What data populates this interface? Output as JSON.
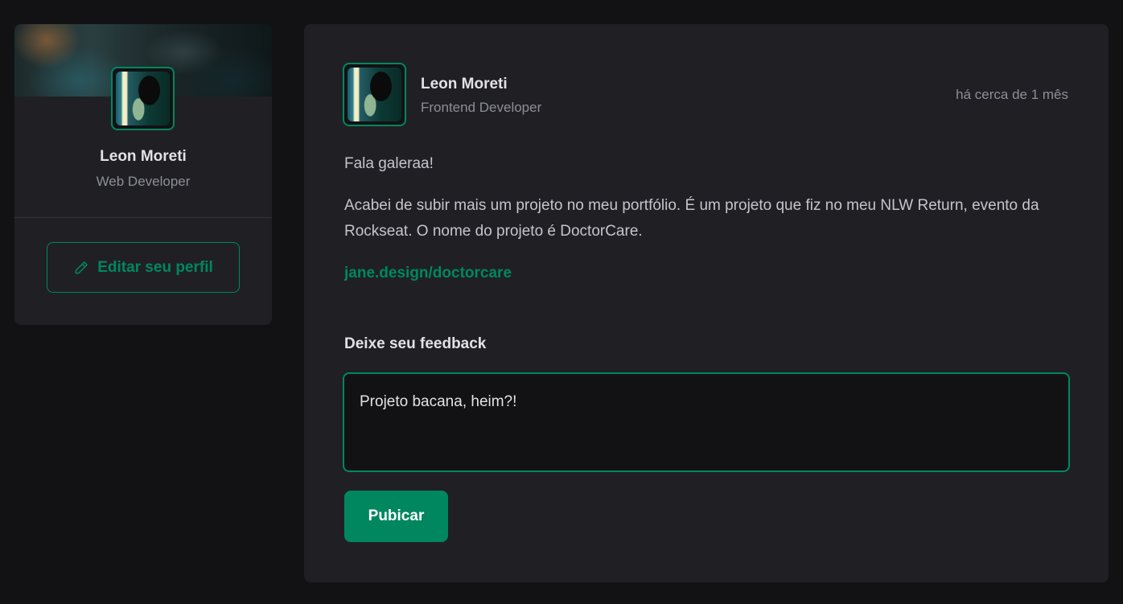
{
  "colors": {
    "background": "#121214",
    "card": "#202024",
    "accent": "#00875f",
    "text": "#e1e1e6",
    "muted": "#8d8d99"
  },
  "sidebar": {
    "name": "Leon Moreti",
    "role": "Web Developer",
    "edit_button_label": "Editar seu perfil",
    "edit_icon": "pencil-icon"
  },
  "post": {
    "author_name": "Leon Moreti",
    "author_role": "Frontend Developer",
    "time": "há cerca de 1 mês",
    "paragraphs": [
      "Fala galeraa!",
      "Acabei de subir mais um projeto no meu portfólio. É um projeto que fiz no meu NLW Return, evento da Rockseat. O nome do projeto é DoctorCare."
    ],
    "link_text": "jane.design/doctorcare"
  },
  "feedback": {
    "title": "Deixe seu feedback",
    "comment_value": "Projeto bacana, heim?!",
    "publish_label": "Pubicar"
  }
}
